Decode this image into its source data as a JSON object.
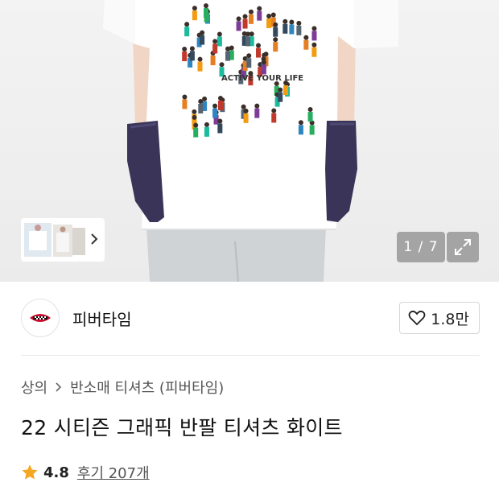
{
  "gallery": {
    "counter": "1 / 7",
    "shirt_print_text": "ACTIVE YOUR LIFE",
    "thumbnails": [
      "thumb-1",
      "thumb-2",
      "thumb-3"
    ],
    "thumb_arrow_icon": "chevron-right-icon",
    "expand_icon": "expand-icon"
  },
  "brand": {
    "name": "피버타임",
    "like_count": "1.8만",
    "like_icon": "heart-outline-icon"
  },
  "breadcrumb": {
    "items": [
      "상의",
      "반소매 티셔츠 (피버타임)"
    ],
    "separator_icon": "chevron-right-icon"
  },
  "product": {
    "title": "22 시티즌 그래픽 반팔 티셔츠 화이트",
    "rating": "4.8",
    "reviews_label": "후기 207개",
    "star_color": "#f5a623"
  }
}
